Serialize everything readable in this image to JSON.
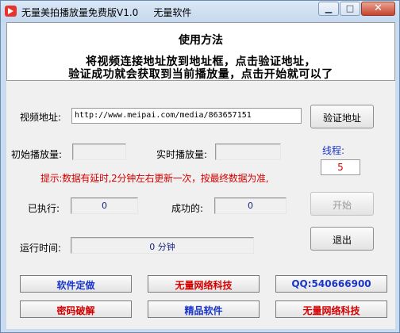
{
  "window": {
    "title": "无量美拍播放量免费版V1.0     无量软件",
    "minimize_glyph": "▁",
    "maximize_glyph": "□",
    "close_glyph": "✕"
  },
  "notice": {
    "title": "使用方法",
    "line1": "将视频连接地址放到地址框，点击验证地址，",
    "line2": "验证成功就会获取到当前播放量，点击开始就可以了"
  },
  "form": {
    "url_label": "视频地址:",
    "url_value": "http://www.meipai.com/media/863657151",
    "verify_button": "验证地址",
    "initial_label": "初始播放量:",
    "initial_value": "",
    "realtime_label": "实时播放量:",
    "realtime_value": "",
    "thread_label": "线程:",
    "thread_value": "5",
    "hint": "提示:数据有延时,2分钟左右更新一次，按最终数据为准,",
    "executed_label": "已执行:",
    "executed_value": "0",
    "success_label": "成功的:",
    "success_value": "0",
    "start_button": "开始",
    "runtime_label": "运行时间:",
    "runtime_value": "0 分钟",
    "exit_button": "退出"
  },
  "bottom_buttons": {
    "row1": [
      "软件定做",
      "无量网络科技",
      "QQ:540666900"
    ],
    "row2": [
      "密码破解",
      "精品软件",
      "无量网络科技"
    ]
  },
  "colors": {
    "accent_blue": "#1a35c8",
    "accent_red": "#d40000",
    "title_bar": "#c9dcef"
  }
}
